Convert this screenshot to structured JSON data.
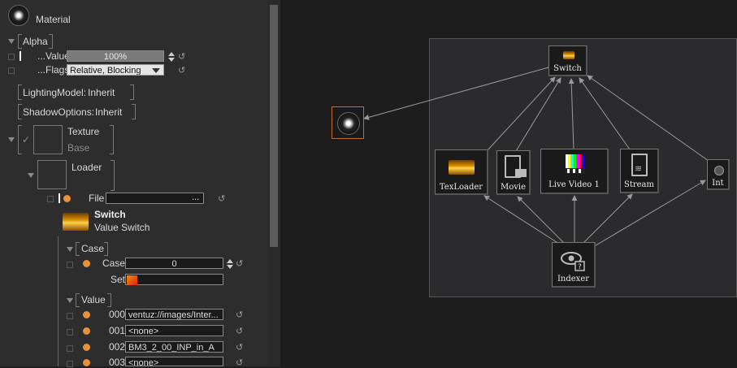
{
  "material": {
    "title": "Material"
  },
  "alpha": {
    "label": "Alpha",
    "value_label": "...Value",
    "value": "100%",
    "flags_label": "...Flags",
    "flags_value": "Relative, Blocking"
  },
  "lighting": {
    "label": "LightingModel:",
    "value": "Inherit"
  },
  "shadow": {
    "label": "ShadowOptions:",
    "value": "Inherit"
  },
  "texture": {
    "label": "Texture",
    "sublabel": "Base"
  },
  "loader": {
    "label": "Loader",
    "file_label": "File",
    "file_button": "..."
  },
  "switch_node": {
    "title": "Switch",
    "subtitle": "Value Switch"
  },
  "case_group": {
    "label": "Case",
    "case_label": "Case",
    "case_value": "0",
    "set_label": "Set"
  },
  "value_group": {
    "label": "Value",
    "rows": [
      {
        "index": "000",
        "value": "ventuz://images/Inter..."
      },
      {
        "index": "001",
        "value": "<none>"
      },
      {
        "index": "002",
        "value": "BM3_2_00_INP_in_A"
      },
      {
        "index": "003",
        "value": "<none>"
      }
    ]
  },
  "graph": {
    "nodes": {
      "switch": "Switch",
      "texloader": "TexLoader",
      "movie": "Movie",
      "livevideo": "Live Video 1",
      "stream": "Stream",
      "int": "Int",
      "indexer": "Indexer"
    }
  },
  "colors": {
    "accent_orange": "#e8903a",
    "panel_bg": "#2d2d2d",
    "graph_bg": "#1d1d1d",
    "group_bg": "#2b2b2e"
  }
}
